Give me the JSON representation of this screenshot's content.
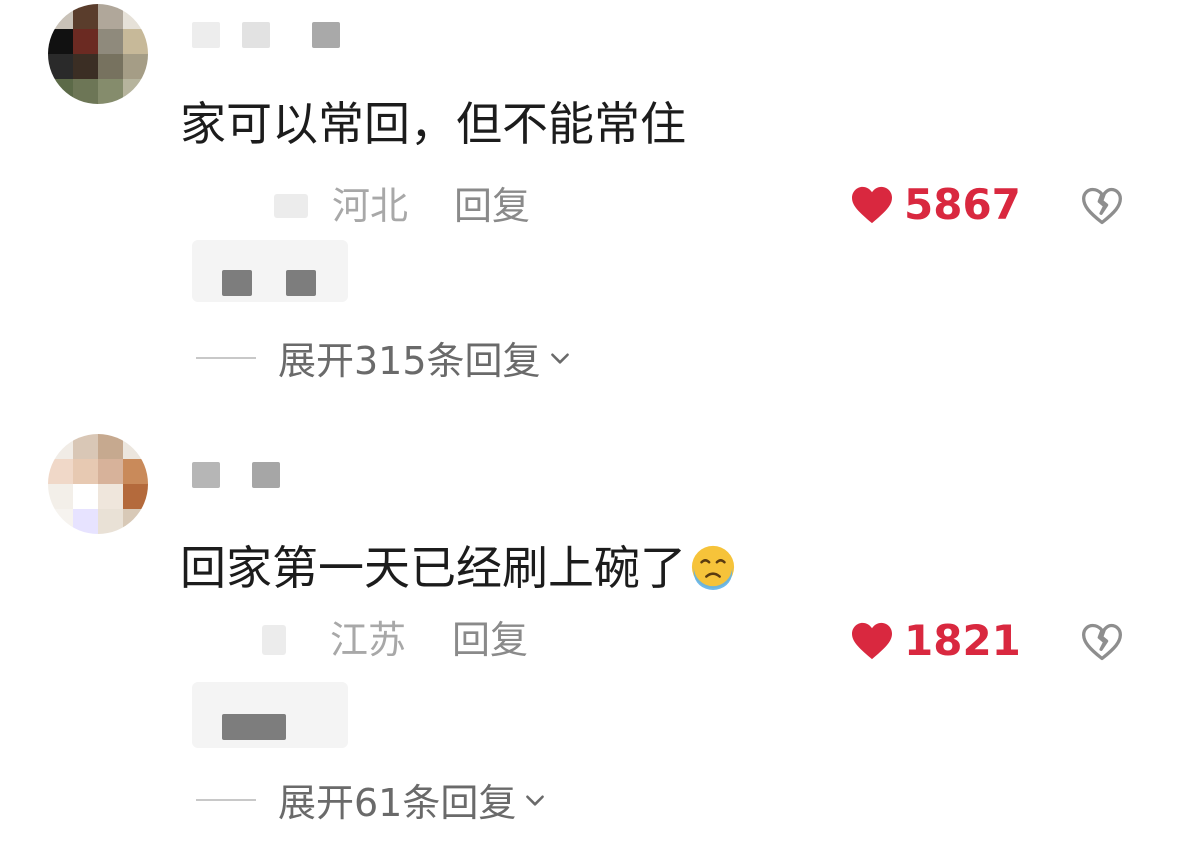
{
  "comments": [
    {
      "text": "家可以常回，但不能常住",
      "location": "河北",
      "reply_label": "回复",
      "likes": "5867",
      "expand_label": "展开315条回复"
    },
    {
      "text": "回家第一天已经刷上碗了",
      "emoji": "crying-face-emoji",
      "location": "江苏",
      "reply_label": "回复",
      "likes": "1821",
      "expand_label": "展开61条回复"
    }
  ],
  "colors": {
    "like": "#d9283f",
    "meta": "#a8a8a8",
    "text": "#1c1c1c"
  },
  "icons": [
    "heart-icon",
    "broken-heart-icon",
    "chevron-down-icon"
  ]
}
